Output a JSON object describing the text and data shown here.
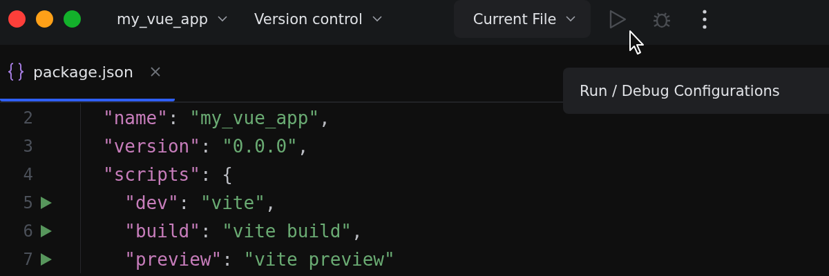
{
  "toolbar": {
    "project": {
      "label": "my_vue_app"
    },
    "vcs": {
      "label": "Version control"
    },
    "run_config": {
      "label": "Current File"
    },
    "actions": [
      {
        "kind": "run",
        "disabled": true
      },
      {
        "kind": "debug",
        "disabled": true
      },
      {
        "kind": "more",
        "disabled": false
      }
    ]
  },
  "tabs": [
    {
      "label": "package.json",
      "selected": true
    }
  ],
  "tooltip": {
    "text": "Run / Debug Configurations"
  },
  "editor": {
    "lines": [
      {
        "number": "2",
        "run": false,
        "tokens": [
          {
            "kind": "key",
            "text": "\"name\""
          },
          {
            "kind": "punct",
            "text": ": "
          },
          {
            "kind": "string",
            "text": "\"my_vue_app\""
          },
          {
            "kind": "punct",
            "text": ","
          }
        ]
      },
      {
        "number": "3",
        "run": false,
        "tokens": [
          {
            "kind": "key",
            "text": "\"version\""
          },
          {
            "kind": "punct",
            "text": ": "
          },
          {
            "kind": "string",
            "text": "\"0.0.0\""
          },
          {
            "kind": "punct",
            "text": ","
          }
        ]
      },
      {
        "number": "4",
        "run": false,
        "tokens": [
          {
            "kind": "key",
            "text": "\"scripts\""
          },
          {
            "kind": "punct",
            "text": ": {"
          }
        ],
        "children": [
          {
            "number": "5",
            "run": true,
            "tokens": [
              {
                "kind": "key",
                "text": "\"dev\""
              },
              {
                "kind": "punct",
                "text": ": "
              },
              {
                "kind": "string",
                "text": "\"vite\""
              },
              {
                "kind": "punct",
                "text": ","
              }
            ]
          },
          {
            "number": "6",
            "run": true,
            "tokens": [
              {
                "kind": "key",
                "text": "\"build\""
              },
              {
                "kind": "punct",
                "text": ": "
              },
              {
                "kind": "string",
                "text": "\"vite build\""
              },
              {
                "kind": "punct",
                "text": ","
              }
            ]
          },
          {
            "number": "7",
            "run": true,
            "tokens": [
              {
                "kind": "key",
                "text": "\"preview\""
              },
              {
                "kind": "punct",
                "text": ": "
              },
              {
                "kind": "string",
                "text": "\"vite preview\""
              }
            ]
          }
        ]
      }
    ]
  }
}
